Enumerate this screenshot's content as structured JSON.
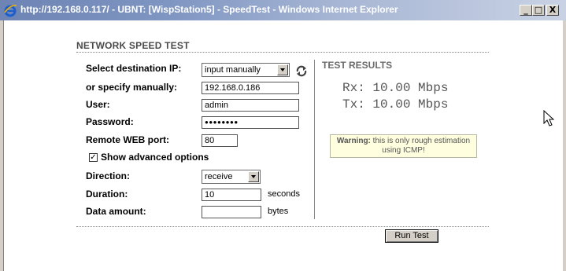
{
  "window": {
    "title": "http://192.168.0.117/ - UBNT: [WispStation5] - SpeedTest - Windows Internet Explorer",
    "minimize": "_",
    "maximize": "□",
    "close": "X"
  },
  "form": {
    "section_title": "NETWORK SPEED TEST",
    "dest_ip_label": "Select destination IP:",
    "dest_ip_value": "input manually",
    "manual_label": "or specify manually:",
    "manual_value": "192.168.0.186",
    "user_label": "User:",
    "user_value": "admin",
    "password_label": "Password:",
    "password_value": "●●●●●●●●",
    "port_label": "Remote WEB port:",
    "port_value": "80",
    "advanced_label": "Show advanced options",
    "advanced_checked": "✓",
    "direction_label": "Direction:",
    "direction_value": "receive",
    "duration_label": "Duration:",
    "duration_value": "10",
    "duration_unit": "seconds",
    "data_amount_label": "Data amount:",
    "data_amount_value": "",
    "data_amount_unit": "bytes"
  },
  "results": {
    "title": "TEST RESULTS",
    "rx": "Rx: 10.00 Mbps",
    "tx": "Tx: 10.00 Mbps",
    "warning_bold": "Warning:",
    "warning_text": " this is only rough estimation using ICMP!"
  },
  "actions": {
    "run_test": "Run Test"
  },
  "icons": {
    "browser": "ie-icon",
    "refresh": "refresh-icon",
    "pointer": "mouse-cursor-icon"
  }
}
